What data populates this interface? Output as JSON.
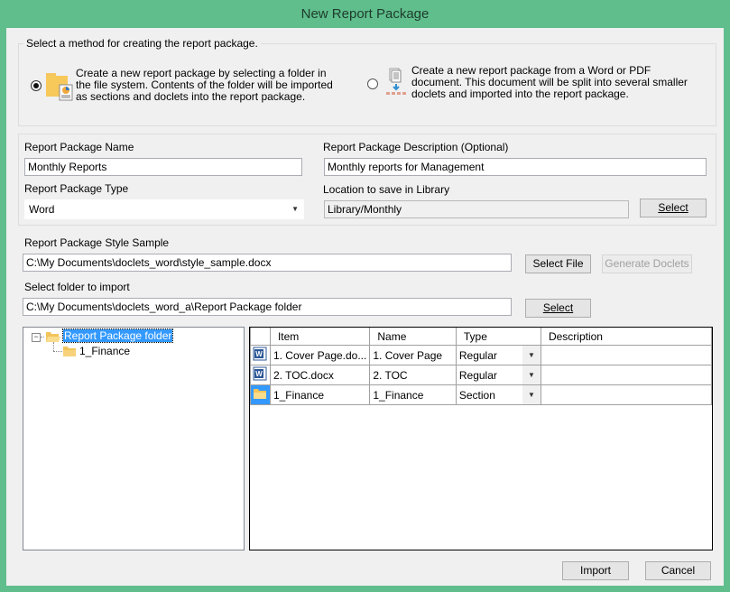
{
  "window": {
    "title": "New Report Package"
  },
  "method_group": {
    "legend": "Select a method for creating the report package.",
    "options": [
      {
        "icon": "folder-report-icon",
        "selected": true,
        "text": "Create a new report package by selecting a folder in the file system. Contents of the folder will be imported as sections and doclets into the report package."
      },
      {
        "icon": "document-split-icon",
        "selected": false,
        "text": "Create a new report package from a Word or PDF document. This document will be split into several smaller doclets and imported into the report package."
      }
    ]
  },
  "form": {
    "name_label": "Report Package Name",
    "name_value": "Monthly Reports",
    "description_label": "Report Package Description (Optional)",
    "description_value": "Monthly reports for Management",
    "type_label": "Report Package Type",
    "type_value": "Word",
    "location_label": "Location to save in Library",
    "location_value": "Library/Monthly",
    "location_select_button": "Select",
    "style_label": "Report Package Style Sample",
    "style_value": "C:\\My Documents\\doclets_word\\style_sample.docx",
    "select_file_button": "Select File",
    "generate_doclets_button": "Generate Doclets",
    "folder_label": "Select folder to import",
    "folder_value": "C:\\My Documents\\doclets_word_a\\Report Package folder",
    "folder_select_button": "Select"
  },
  "tree": {
    "root": {
      "label": "Report Package folder",
      "expanded": true,
      "selected": true
    },
    "children": [
      {
        "label": "1_Finance"
      }
    ]
  },
  "grid": {
    "columns": [
      "",
      "Item",
      "Name",
      "Type",
      "Description"
    ],
    "rows": [
      {
        "icon": "word-doc-icon",
        "item": "1. Cover Page.do...",
        "name": "1. Cover Page",
        "type": "Regular",
        "description": ""
      },
      {
        "icon": "word-doc-icon",
        "item": "2. TOC.docx",
        "name": "2. TOC",
        "type": "Regular",
        "description": ""
      },
      {
        "icon": "folder-icon",
        "item": "1_Finance",
        "name": "1_Finance",
        "type": "Section",
        "description": ""
      }
    ]
  },
  "footer": {
    "import_button": "Import",
    "cancel_button": "Cancel"
  },
  "colors": {
    "frame": "#5fbe8c",
    "selection": "#3399ff"
  }
}
